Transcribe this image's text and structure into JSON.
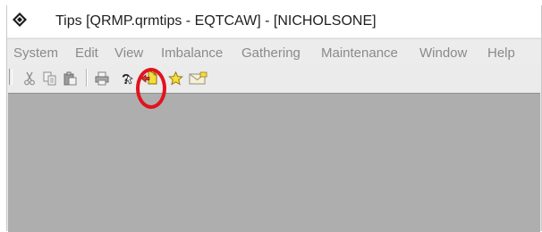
{
  "window": {
    "title": "Tips [QRMP.qrmtips - EQTCAW] - [NICHOLSONE]",
    "app_icon": "diamond-app-icon"
  },
  "menubar": {
    "items": [
      "System",
      "Edit",
      "View",
      "Imbalance",
      "Gathering",
      "Maintenance",
      "Window",
      "Help"
    ]
  },
  "toolbar": {
    "buttons": [
      "cut-icon",
      "copy-icon",
      "paste-icon",
      "print-icon",
      "help-icon",
      "tips-icon",
      "favorites-star-icon",
      "mail-icon"
    ],
    "highlighted_button": "tips-icon"
  },
  "colors": {
    "client_area": "#aeaeae",
    "highlight_circle": "#e2131f",
    "menu_text": "#8a8a8a"
  }
}
